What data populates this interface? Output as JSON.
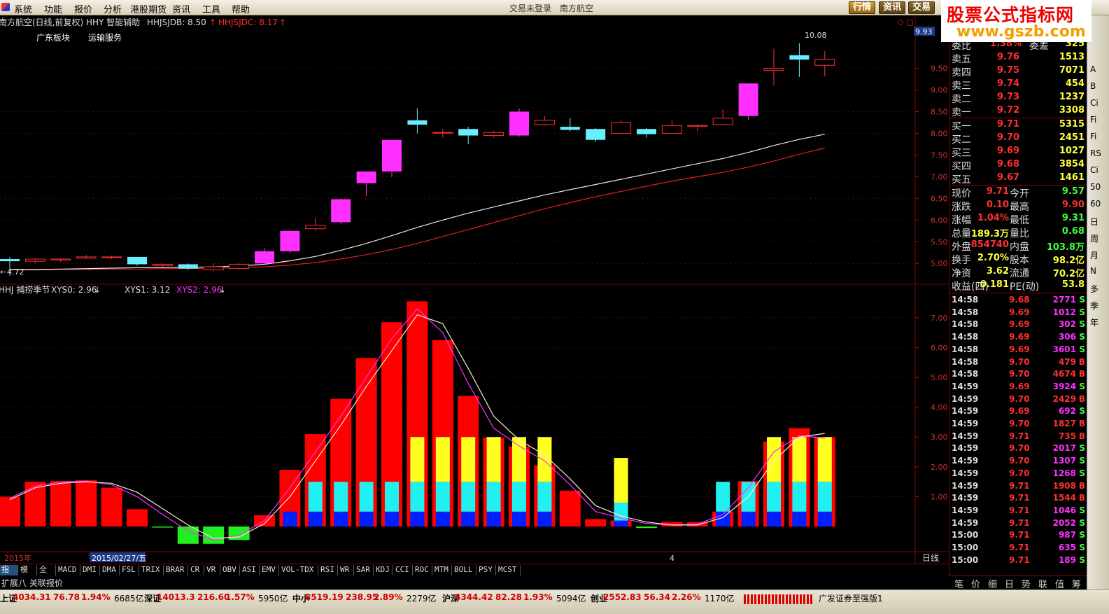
{
  "menu": {
    "items": [
      "系统",
      "功能",
      "报价",
      "分析",
      "港股期货",
      "资讯",
      "工具",
      "帮助"
    ],
    "login_status": "交易未登录",
    "stock_name": "南方航空",
    "buttons": [
      "行情",
      "资讯",
      "交易"
    ],
    "active_button": "行情"
  },
  "brand": {
    "title": "股票公式指标网",
    "url": "www.gszb.com"
  },
  "main_chart": {
    "header_name": "南方航空(日线,前复权) HHY 智能辅助",
    "hhjsjdb": "HHJSJDB: 8.50",
    "hhjsjdc": "HHJSJDC: 8.17",
    "sector_1": "广东板块",
    "sector_2": "运输服务",
    "price_hi_label": "10.08",
    "price_lo_label": "4.72",
    "current_price_tag": "9.93",
    "y_ticks": [
      "9.50",
      "9.00",
      "8.50",
      "8.00",
      "7.50",
      "7.00",
      "6.50",
      "6.00",
      "5.50",
      "5.00"
    ]
  },
  "sub_chart": {
    "header_name": "HHJ 捕捞季节",
    "xys0": "XYS0: 2.96",
    "xys1": "XYS1: 3.12",
    "xys2": "XYS2: 2.96",
    "y_ticks": [
      "7.00",
      "6.00",
      "5.00",
      "4.00",
      "3.00",
      "2.00",
      "1.00"
    ]
  },
  "time_axis": {
    "year_label": "2015年",
    "cursor_date": "2015/02/27/五",
    "month_mark": "4",
    "period": "日线",
    "zoom_controls": [
      "+",
      "-",
      "×"
    ]
  },
  "chart_data": {
    "type": "candlestick",
    "candles": [
      {
        "o": 5.1,
        "c": 5.05,
        "h": 5.15,
        "l": 4.72
      },
      {
        "o": 5.05,
        "c": 5.1,
        "h": 5.12,
        "l": 5.0
      },
      {
        "o": 5.08,
        "c": 5.1,
        "h": 5.12,
        "l": 5.03
      },
      {
        "o": 5.12,
        "c": 5.15,
        "h": 5.2,
        "l": 5.1
      },
      {
        "o": 5.15,
        "c": 5.15,
        "h": 5.18,
        "l": 5.1
      },
      {
        "o": 5.15,
        "c": 4.98,
        "h": 5.15,
        "l": 4.95
      },
      {
        "o": 4.95,
        "c": 4.98,
        "h": 5.0,
        "l": 4.92
      },
      {
        "o": 4.98,
        "c": 4.88,
        "h": 5.0,
        "l": 4.85
      },
      {
        "o": 4.85,
        "c": 4.92,
        "h": 5.0,
        "l": 4.82
      },
      {
        "o": 4.88,
        "c": 4.98,
        "h": 5.0,
        "l": 4.85
      },
      {
        "o": 5.0,
        "c": 5.28,
        "h": 5.35,
        "l": 4.98
      },
      {
        "o": 5.28,
        "c": 5.75,
        "h": 5.75,
        "l": 5.25
      },
      {
        "o": 5.8,
        "c": 5.88,
        "h": 6.05,
        "l": 5.75
      },
      {
        "o": 5.95,
        "c": 6.48,
        "h": 6.5,
        "l": 5.9
      },
      {
        "o": 6.85,
        "c": 7.12,
        "h": 7.12,
        "l": 6.55
      },
      {
        "o": 7.12,
        "c": 7.85,
        "h": 7.85,
        "l": 7.0
      },
      {
        "o": 8.3,
        "c": 8.2,
        "h": 8.58,
        "l": 8.0
      },
      {
        "o": 8.02,
        "c": 8.02,
        "h": 8.1,
        "l": 7.9
      },
      {
        "o": 8.1,
        "c": 7.95,
        "h": 8.15,
        "l": 7.75
      },
      {
        "o": 7.95,
        "c": 8.02,
        "h": 8.06,
        "l": 7.9
      },
      {
        "o": 7.95,
        "c": 8.5,
        "h": 8.58,
        "l": 7.92
      },
      {
        "o": 8.2,
        "c": 8.3,
        "h": 8.4,
        "l": 8.18
      },
      {
        "o": 8.15,
        "c": 8.08,
        "h": 8.35,
        "l": 8.05
      },
      {
        "o": 8.1,
        "c": 7.85,
        "h": 8.12,
        "l": 7.8
      },
      {
        "o": 8.0,
        "c": 8.25,
        "h": 8.3,
        "l": 7.98
      },
      {
        "o": 8.1,
        "c": 7.98,
        "h": 8.12,
        "l": 7.9
      },
      {
        "o": 8.0,
        "c": 8.18,
        "h": 8.3,
        "l": 7.98
      },
      {
        "o": 8.18,
        "c": 8.18,
        "h": 8.2,
        "l": 8.05
      },
      {
        "o": 8.2,
        "c": 8.35,
        "h": 8.55,
        "l": 8.18
      },
      {
        "o": 8.4,
        "c": 9.15,
        "h": 9.15,
        "l": 8.3
      },
      {
        "o": 9.45,
        "c": 9.5,
        "h": 9.95,
        "l": 9.1
      },
      {
        "o": 9.8,
        "c": 9.7,
        "h": 10.08,
        "l": 9.3
      },
      {
        "o": 9.57,
        "c": 9.71,
        "h": 9.9,
        "l": 9.31
      }
    ],
    "ma_white": [
      4.86,
      4.86,
      4.87,
      4.88,
      4.89,
      4.9,
      4.9,
      4.91,
      4.92,
      4.94,
      4.98,
      5.06,
      5.16,
      5.3,
      5.46,
      5.64,
      5.83,
      6.0,
      6.16,
      6.3,
      6.44,
      6.58,
      6.7,
      6.82,
      6.94,
      7.06,
      7.18,
      7.3,
      7.42,
      7.56,
      7.72,
      7.86,
      7.98
    ],
    "ma_red": [
      4.85,
      4.85,
      4.86,
      4.86,
      4.87,
      4.87,
      4.88,
      4.88,
      4.89,
      4.9,
      4.92,
      4.96,
      5.02,
      5.1,
      5.2,
      5.32,
      5.46,
      5.62,
      5.78,
      5.94,
      6.1,
      6.26,
      6.4,
      6.54,
      6.66,
      6.78,
      6.9,
      7.0,
      7.1,
      7.22,
      7.36,
      7.52,
      7.66
    ],
    "sub_bars": [
      1.0,
      1.5,
      1.52,
      1.55,
      1.3,
      0.58,
      -0.02,
      -0.58,
      -0.58,
      -0.45,
      0.38,
      1.9,
      3.1,
      4.28,
      5.65,
      6.85,
      7.55,
      6.25,
      4.38,
      2.98,
      2.68,
      2.05,
      1.2,
      0.25,
      0.2,
      -0.05,
      0.15,
      0.15,
      0.5,
      1.52,
      2.85,
      3.3,
      3.0
    ],
    "sub_blue": [
      0,
      0,
      0,
      0,
      0,
      0,
      0,
      0,
      0,
      0,
      0,
      0.5,
      0.5,
      0.5,
      0.5,
      0.5,
      0.5,
      0.5,
      0.5,
      0.5,
      0.5,
      0.5,
      0,
      0,
      0.2,
      0,
      0,
      0,
      0.5,
      0.5,
      0.5,
      0.5,
      0.5
    ],
    "sub_cyan": [
      0,
      0,
      0,
      0,
      0,
      0,
      0,
      0,
      0,
      0,
      0,
      0,
      1.0,
      1.0,
      1.0,
      1.0,
      1.0,
      1.0,
      1.0,
      1.0,
      1.0,
      1.0,
      0,
      0,
      0.6,
      0,
      0,
      0,
      1.0,
      1.0,
      1.0,
      1.0,
      1.0
    ],
    "sub_yellow": [
      0,
      0,
      0,
      0,
      0,
      0,
      0,
      0,
      0,
      0,
      0,
      0,
      0,
      0,
      0,
      0,
      1.5,
      1.5,
      1.5,
      1.5,
      1.5,
      1.5,
      0,
      0,
      1.5,
      0,
      0,
      0,
      0,
      0,
      1.5,
      1.5,
      1.5
    ],
    "sub_line_white": [
      0.9,
      1.3,
      1.45,
      1.5,
      1.45,
      1.15,
      0.6,
      0.05,
      -0.4,
      -0.35,
      0.1,
      1.0,
      2.2,
      3.4,
      4.7,
      5.9,
      7.1,
      6.8,
      5.3,
      3.7,
      2.9,
      2.4,
      1.6,
      0.7,
      0.35,
      0.15,
      0.05,
      0.05,
      0.3,
      1.0,
      2.2,
      3.0,
      3.12
    ],
    "sub_line_magenta": [
      0.95,
      1.35,
      1.5,
      1.52,
      1.4,
      1.0,
      0.4,
      -0.15,
      -0.45,
      -0.3,
      0.2,
      1.3,
      2.5,
      3.7,
      5.0,
      6.3,
      7.3,
      6.5,
      4.8,
      3.3,
      2.7,
      2.2,
      1.4,
      0.5,
      0.28,
      0.1,
      0.05,
      0.08,
      0.4,
      1.3,
      2.5,
      3.05,
      2.96
    ],
    "price_ylim": [
      4.6,
      10.3
    ],
    "sub_ylim": [
      -0.75,
      7.7
    ]
  },
  "quote": {
    "top_partial": {
      "label": "委比",
      "value": "1.38%",
      "label2": "委差",
      "value2": "325"
    },
    "asks": [
      {
        "label": "卖五",
        "price": "9.76",
        "vol": "1513"
      },
      {
        "label": "卖四",
        "price": "9.75",
        "vol": "7071"
      },
      {
        "label": "卖三",
        "price": "9.74",
        "vol": "454"
      },
      {
        "label": "卖二",
        "price": "9.73",
        "vol": "1237"
      },
      {
        "label": "卖一",
        "price": "9.72",
        "vol": "3308"
      }
    ],
    "bids": [
      {
        "label": "买一",
        "price": "9.71",
        "vol": "5315"
      },
      {
        "label": "买二",
        "price": "9.70",
        "vol": "2451"
      },
      {
        "label": "买三",
        "price": "9.69",
        "vol": "1027"
      },
      {
        "label": "买四",
        "price": "9.68",
        "vol": "3854"
      },
      {
        "label": "买五",
        "price": "9.67",
        "vol": "1461"
      }
    ],
    "stats": [
      {
        "l1": "现价",
        "v1": "9.71",
        "c1": "#ff3030",
        "l2": "今开",
        "v2": "9.57",
        "c2": "#40ff40"
      },
      {
        "l1": "涨跌",
        "v1": "0.10",
        "c1": "#ff3030",
        "l2": "最高",
        "v2": "9.90",
        "c2": "#ff3030"
      },
      {
        "l1": "涨幅",
        "v1": "1.04%",
        "c1": "#ff3030",
        "l2": "最低",
        "v2": "9.31",
        "c2": "#40ff40"
      },
      {
        "l1": "总量",
        "v1": "189.3万",
        "c1": "#ffff40",
        "l2": "量比",
        "v2": "0.68",
        "c2": "#40ff40"
      },
      {
        "l1": "外盘",
        "v1": "854740",
        "c1": "#ff3030",
        "l2": "内盘",
        "v2": "103.8万",
        "c2": "#40ff40"
      },
      {
        "l1": "换手",
        "v1": "2.70%",
        "c1": "#ffff40",
        "l2": "股本",
        "v2": "98.2亿",
        "c2": "#ffff40"
      },
      {
        "l1": "净资",
        "v1": "3.62",
        "c1": "#ffff40",
        "l2": "流通",
        "v2": "70.2亿",
        "c2": "#ffff40"
      },
      {
        "l1": "收益(四)",
        "v1": "0.181",
        "c1": "#ffff40",
        "l2": "PE(动)",
        "v2": "53.8",
        "c2": "#ffff40"
      }
    ],
    "ticks": [
      {
        "t": "14:58",
        "p": "9.68",
        "v": "2771",
        "s": "S"
      },
      {
        "t": "14:58",
        "p": "9.69",
        "v": "1012",
        "s": "S"
      },
      {
        "t": "14:58",
        "p": "9.69",
        "v": "302",
        "s": "S"
      },
      {
        "t": "14:58",
        "p": "9.69",
        "v": "306",
        "s": "S"
      },
      {
        "t": "14:58",
        "p": "9.69",
        "v": "3601",
        "s": "S"
      },
      {
        "t": "14:58",
        "p": "9.70",
        "v": "479",
        "s": "B"
      },
      {
        "t": "14:58",
        "p": "9.70",
        "v": "4674",
        "s": "B"
      },
      {
        "t": "14:59",
        "p": "9.69",
        "v": "3924",
        "s": "S"
      },
      {
        "t": "14:59",
        "p": "9.70",
        "v": "2429",
        "s": "B"
      },
      {
        "t": "14:59",
        "p": "9.69",
        "v": "692",
        "s": "S"
      },
      {
        "t": "14:59",
        "p": "9.70",
        "v": "1827",
        "s": "B"
      },
      {
        "t": "14:59",
        "p": "9.71",
        "v": "735",
        "s": "B"
      },
      {
        "t": "14:59",
        "p": "9.70",
        "v": "2017",
        "s": "S"
      },
      {
        "t": "14:59",
        "p": "9.70",
        "v": "1307",
        "s": "S"
      },
      {
        "t": "14:59",
        "p": "9.70",
        "v": "1268",
        "s": "S"
      },
      {
        "t": "14:59",
        "p": "9.71",
        "v": "1908",
        "s": "B"
      },
      {
        "t": "14:59",
        "p": "9.71",
        "v": "1544",
        "s": "B"
      },
      {
        "t": "14:59",
        "p": "9.71",
        "v": "1046",
        "s": "S"
      },
      {
        "t": "14:59",
        "p": "9.71",
        "v": "2052",
        "s": "S"
      },
      {
        "t": "15:00",
        "p": "9.71",
        "v": "987",
        "s": "S"
      },
      {
        "t": "15:00",
        "p": "9.71",
        "v": "635",
        "s": "S"
      },
      {
        "t": "15:00",
        "p": "9.71",
        "v": "189",
        "s": "S"
      }
    ],
    "tabs": [
      "笔",
      "价",
      "细",
      "日",
      "势",
      "联",
      "值",
      "筹"
    ]
  },
  "right_toolbar": [
    "A",
    "B",
    "Ci",
    "Fi",
    "Fi",
    "RS",
    "Ci",
    "50",
    "60",
    "日",
    "周",
    "月",
    "N",
    "多",
    "季",
    "年"
  ],
  "indicator_tabs": [
    "指标",
    "模板",
    "全部",
    "MACD",
    "DMI",
    "DMA",
    "FSL",
    "TRIX",
    "BRAR",
    "CR",
    "VR",
    "OBV",
    "ASI",
    "EMV",
    "VOL-TDX",
    "RSI",
    "WR",
    "SAR",
    "KDJ",
    "CCI",
    "ROC",
    "MTM",
    "BOLL",
    "PSY",
    "MCST"
  ],
  "sub_tabs": [
    "扩展八",
    "关联报价"
  ],
  "status_bar": {
    "items": [
      {
        "name": "上证",
        "price": "4034.31",
        "chg": "76.78",
        "pct": "1.94%",
        "amt": "6685亿"
      },
      {
        "name": "深证",
        "price": "14013.3",
        "chg": "216.60",
        "pct": "1.57%",
        "amt": "5950亿"
      },
      {
        "name": "中小",
        "price": "8519.19",
        "chg": "238.95",
        "pct": "2.89%",
        "amt": "2279亿"
      },
      {
        "name": "沪深",
        "price": "4344.42",
        "chg": "82.28",
        "pct": "1.93%",
        "amt": "5094亿"
      },
      {
        "name": "创业",
        "price": "2552.83",
        "chg": "56.34",
        "pct": "2.26%",
        "amt": "1170亿"
      }
    ],
    "message": "广发证券至强版1"
  },
  "colors": {
    "up": "#ff3030",
    "down_fill": "#66f0ff",
    "limit_up": "#ff30ff",
    "bar_red": "#ff0000",
    "bar_green": "#20f020",
    "bar_blue": "#0020ff",
    "bar_cyan": "#20f0f0",
    "bar_yellow": "#ffff20",
    "grid": "#800000"
  }
}
